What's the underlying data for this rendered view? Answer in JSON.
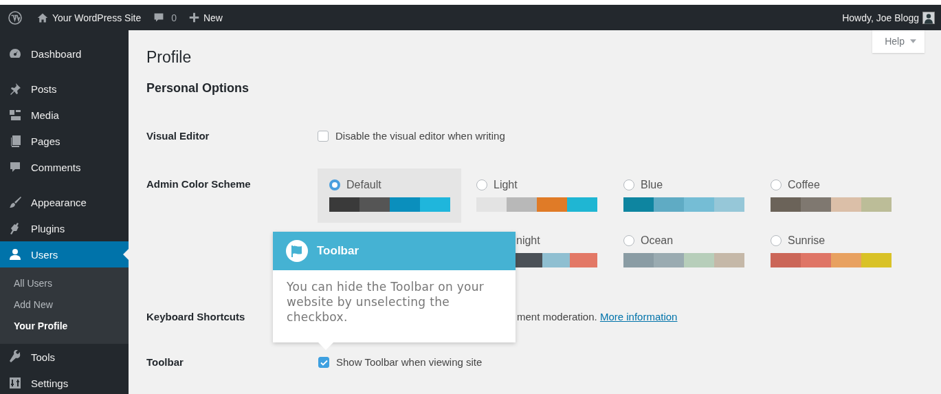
{
  "admin_bar": {
    "site_name": "Your WordPress Site",
    "comments_count": "0",
    "new_label": "New",
    "greeting": "Howdy, Joe Blogg"
  },
  "sidebar": {
    "items": [
      {
        "label": "Dashboard",
        "selected": false
      },
      {
        "label": "Posts",
        "selected": false
      },
      {
        "label": "Media",
        "selected": false
      },
      {
        "label": "Pages",
        "selected": false
      },
      {
        "label": "Comments",
        "selected": false
      },
      {
        "label": "Appearance",
        "selected": false
      },
      {
        "label": "Plugins",
        "selected": false
      },
      {
        "label": "Users",
        "selected": true,
        "children": [
          {
            "label": "All Users",
            "selected": false
          },
          {
            "label": "Add New",
            "selected": false
          },
          {
            "label": "Your Profile",
            "selected": true
          }
        ]
      },
      {
        "label": "Tools",
        "selected": false
      },
      {
        "label": "Settings",
        "selected": false
      }
    ]
  },
  "help_tab": {
    "label": "Help"
  },
  "page": {
    "title": "Profile",
    "section": "Personal Options"
  },
  "fields": [
    {
      "kind": "checkbox",
      "label": "Visual Editor",
      "option": "Disable the visual editor when writing",
      "checked": false
    },
    {
      "kind": "color_schemes",
      "label": "Admin Color Scheme",
      "schemes": [
        {
          "name": "Default",
          "selected": true,
          "swatches": [
            {
              "color": "#3a3a3a"
            },
            {
              "color": "#555555"
            },
            {
              "color": "#0a8fbd"
            },
            {
              "color": "#1fb6dc"
            }
          ]
        },
        {
          "name": "Light",
          "selected": false,
          "swatches": [
            {
              "color": "#e3e3e3"
            },
            {
              "color": "#b8b8b8"
            },
            {
              "color": "#e07b27"
            },
            {
              "color": "#1fb6d3"
            }
          ]
        },
        {
          "name": "Blue",
          "selected": false,
          "swatches": [
            {
              "color": "#0e85a0"
            },
            {
              "color": "#5fabc4"
            },
            {
              "color": "#75bdd5"
            },
            {
              "color": "#96c7d8"
            }
          ]
        },
        {
          "name": "Coffee",
          "selected": false,
          "swatches": [
            {
              "color": "#6b6359"
            },
            {
              "color": "#7f7870"
            },
            {
              "color": "#dbbfa8"
            },
            {
              "color": "#bcbd98"
            }
          ]
        },
        {
          "name": "night",
          "selected": false,
          "swatches": [
            {
              "color": "#4b5157"
            },
            {
              "color": "#8fbfd1"
            },
            {
              "color": "#e37866"
            }
          ]
        },
        {
          "name": "Ocean",
          "selected": false,
          "swatches": [
            {
              "color": "#8a9ca4"
            },
            {
              "color": "#9aabb1"
            },
            {
              "color": "#b7ceba"
            },
            {
              "color": "#c5b8a8"
            }
          ]
        },
        {
          "name": "Sunrise",
          "selected": false,
          "swatches": [
            {
              "color": "#cb6658"
            },
            {
              "color": "#df7566"
            },
            {
              "color": "#e8a160"
            },
            {
              "color": "#d9c227"
            }
          ]
        }
      ]
    },
    {
      "kind": "text",
      "label": "Keyboard Shortcuts",
      "text": "ment moderation.",
      "link": "More information"
    },
    {
      "kind": "checkbox",
      "label": "Toolbar",
      "option": "Show Toolbar when viewing site",
      "checked": true
    }
  ],
  "tooltip": {
    "title": "Toolbar",
    "text": "You can hide the Toolbar on your website by unselecting the checkbox."
  }
}
